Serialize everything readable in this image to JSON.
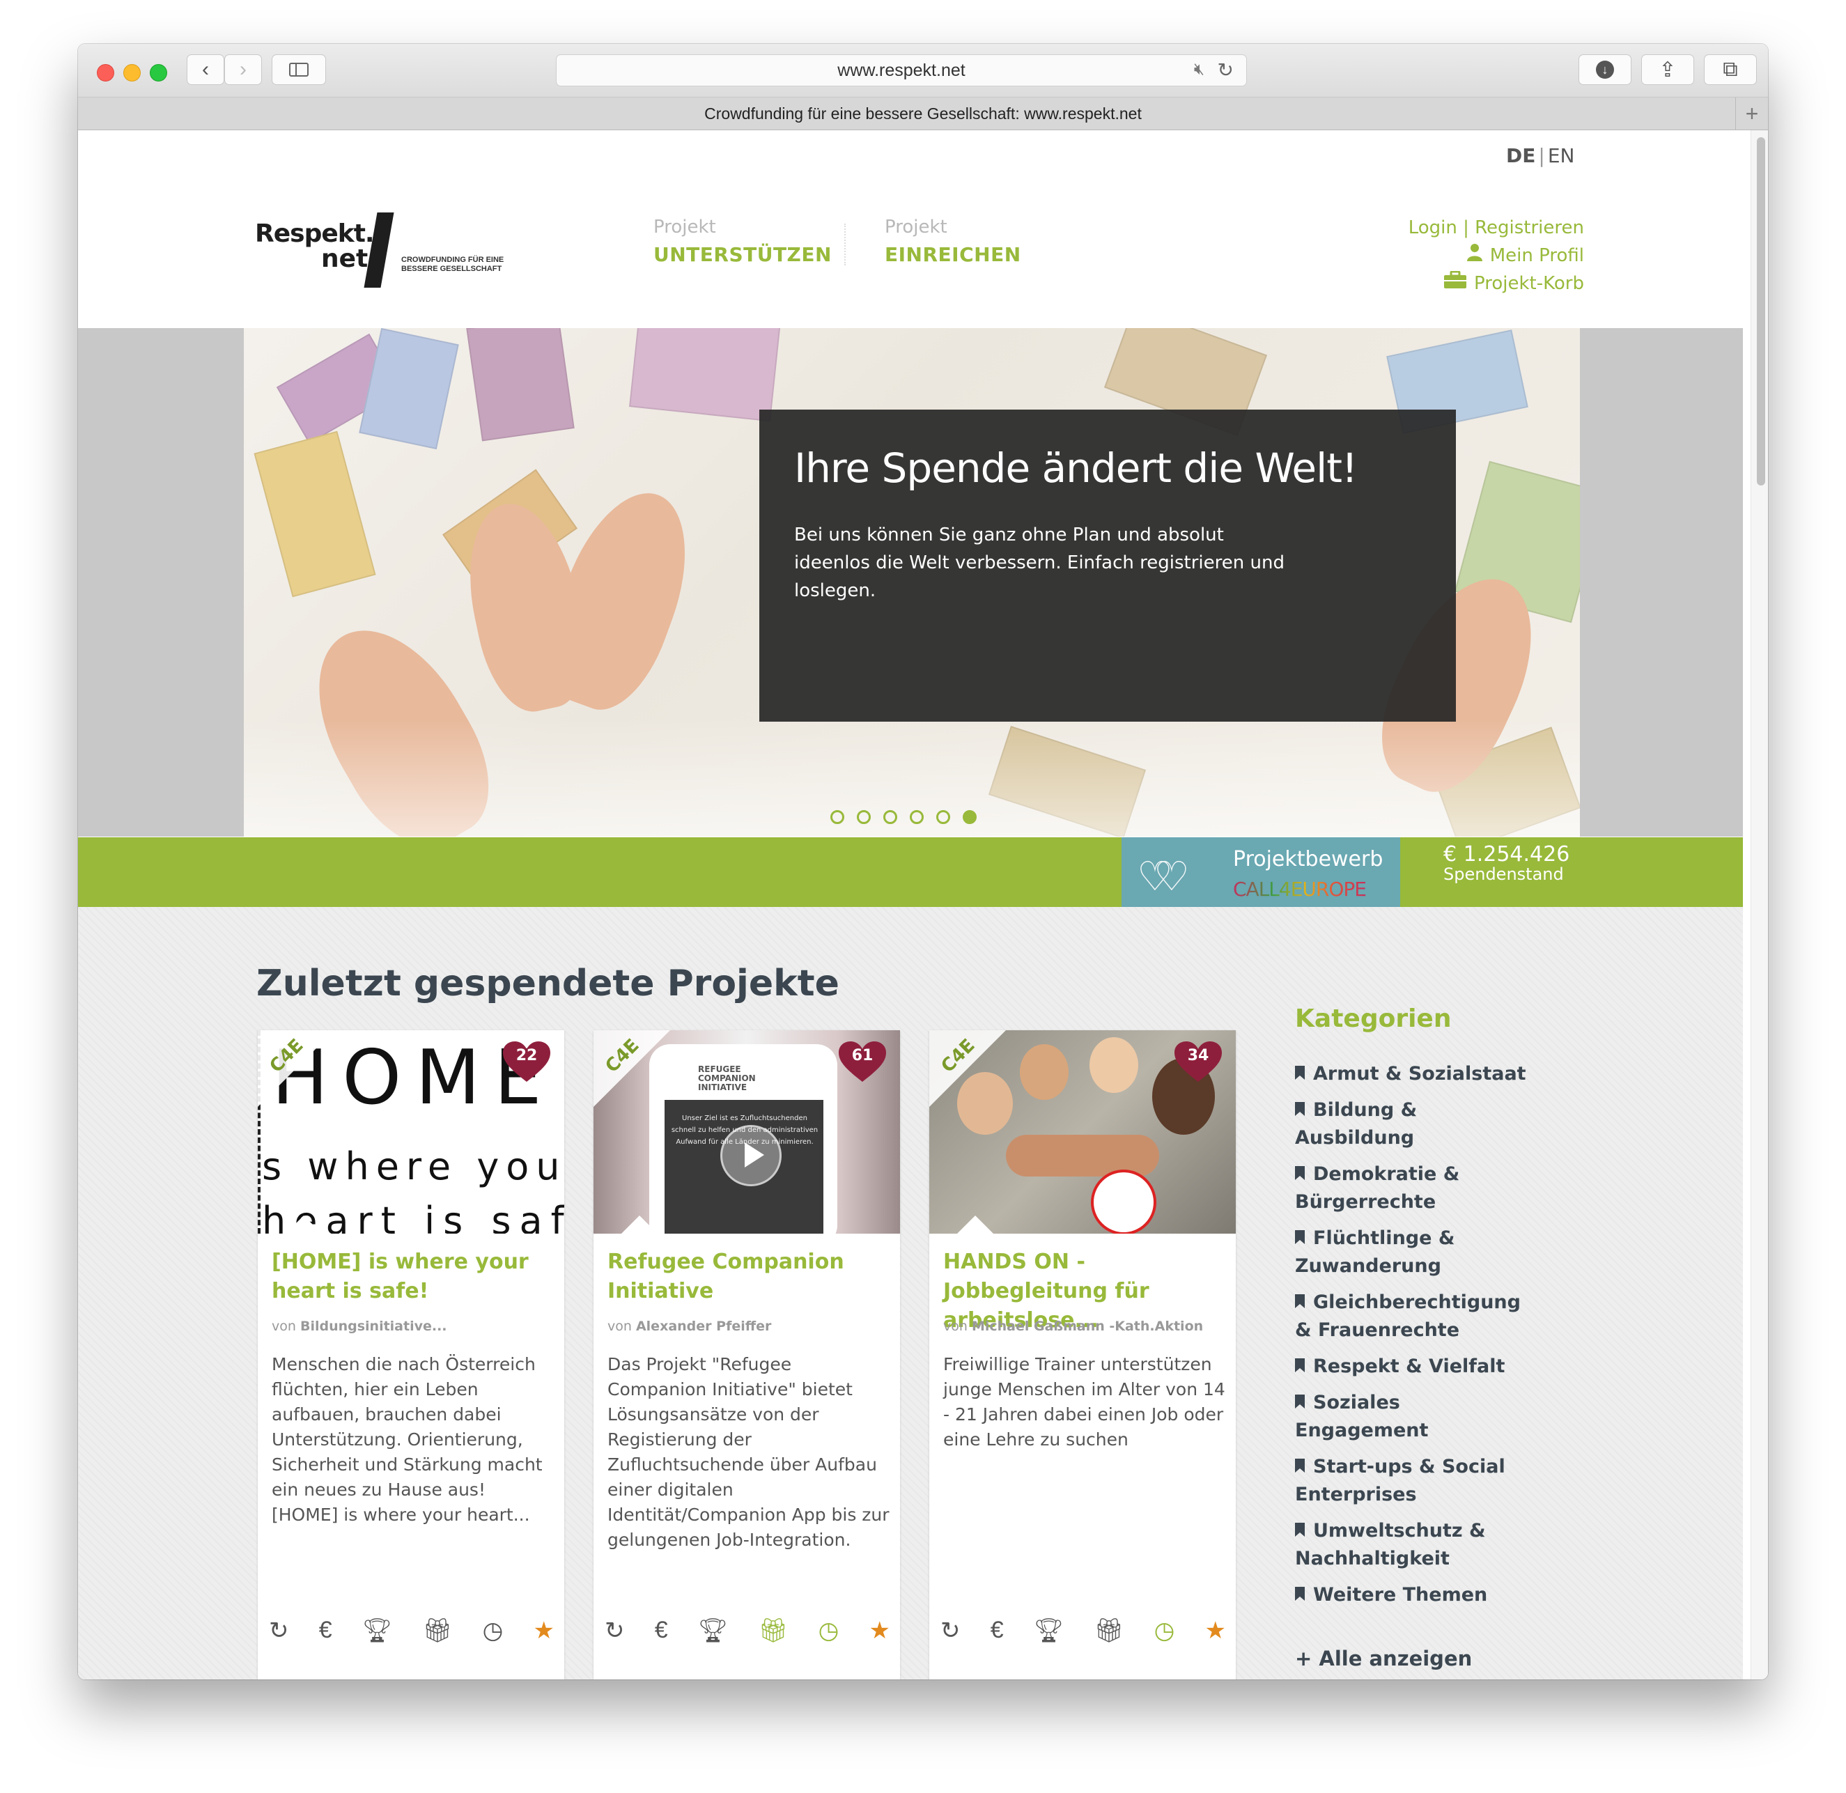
{
  "browser": {
    "url": "www.respekt.net",
    "tab_title": "Crowdfunding für eine bessere Gesellschaft: www.respekt.net",
    "new_tab": "+"
  },
  "header": {
    "lang_de": "DE",
    "lang_sep": "|",
    "lang_en": "EN",
    "logo_line1": "Respekt.",
    "logo_line2": "net",
    "logo_tagline1": "CROWDFUNDING FÜR EINE",
    "logo_tagline2": "BESSERE GESELLSCHAFT",
    "nav": [
      {
        "small": "Projekt",
        "big": "UNTERSTÜTZEN"
      },
      {
        "small": "Projekt",
        "big": "EINREICHEN"
      }
    ],
    "login": "Login | Registrieren",
    "profile": "Mein Profil",
    "cart": "Projekt-Korb"
  },
  "hero": {
    "title": "Ihre Spende ändert die Welt!",
    "text": "Bei uns können Sie ganz ohne Plan und absolut ideenlos die Welt verbessern. Einfach registrieren und loslegen.",
    "slides": 6,
    "active_slide": 6
  },
  "promo": {
    "label": "Projektbewerb",
    "brand": "CALL4EUROPE",
    "amount": "€ 1.254.426",
    "amount_label": "Spendenstand"
  },
  "section": {
    "title": "Zuletzt gespendete Projekte"
  },
  "projects": [
    {
      "hearts": "22",
      "title": "[HOME] is where your heart is safe!",
      "by_prefix": "von",
      "author": "Bildungsinitiative...",
      "description": "Menschen die nach Österreich flüchten, hier ein Leben aufbauen, brauchen dabei Unterstützung. Orientierung, Sicherheit und Stärkung macht ein neues zu Hause aus! [HOME] is where your heart...",
      "thumb_l1": "HOME",
      "thumb_l2": "s where your",
      "thumb_l3": "heart is safe"
    },
    {
      "hearts": "61",
      "title": "Refugee Companion Initiative",
      "by_prefix": "von",
      "author": "Alexander Pfeiffer",
      "description": "Das Projekt \"Refugee Companion Initiative\" bietet Lösungsansätze von der Registierung der Zufluchtsuchende über Aufbau einer digitalen Identität/Companion App bis zur gelungenen Job-Integration.",
      "thumb_logo": "REFUGEE COMPANION INITIATIVE",
      "thumb_text": "Unser Ziel ist es Zufluchtsuchenden schnell zu helfen und den administrativen Aufwand für alle Länder zu minimieren."
    },
    {
      "hearts": "34",
      "title": "HANDS ON - Jobbegleitung für arbeitslose...",
      "by_prefix": "von",
      "author": "Michael Gaßmann -Kath.Aktion",
      "description": "Freiwillige Trainer unterstützen junge Menschen im Alter von 14 - 21 Jahren dabei einen Job oder eine Lehre zu suchen"
    }
  ],
  "card_badge": "C4E",
  "sidebar": {
    "title": "Kategorien",
    "categories": [
      "Armut & Sozialstaat",
      "Bildung & Ausbildung",
      "Demokratie & Bürgerrechte",
      "Flüchtlinge & Zuwanderung",
      "Gleichberechtigung & Frauenrechte",
      "Respekt & Vielfalt",
      "Soziales Engagement",
      "Start-ups & Social Enterprises",
      "Umweltschutz & Nachhaltigkeit",
      "Weitere Themen"
    ],
    "show_all": "+ Alle anzeigen"
  },
  "icons": {
    "card_row": [
      "refresh-icon",
      "euro-icon",
      "trophy-icon",
      "gift-icon",
      "clock-icon",
      "star-icon"
    ]
  },
  "colors": {
    "accent_green": "#98b93a",
    "dark_text": "#3b4650",
    "heart": "#8e1f3c",
    "call4europe": "#6aa8b2"
  }
}
